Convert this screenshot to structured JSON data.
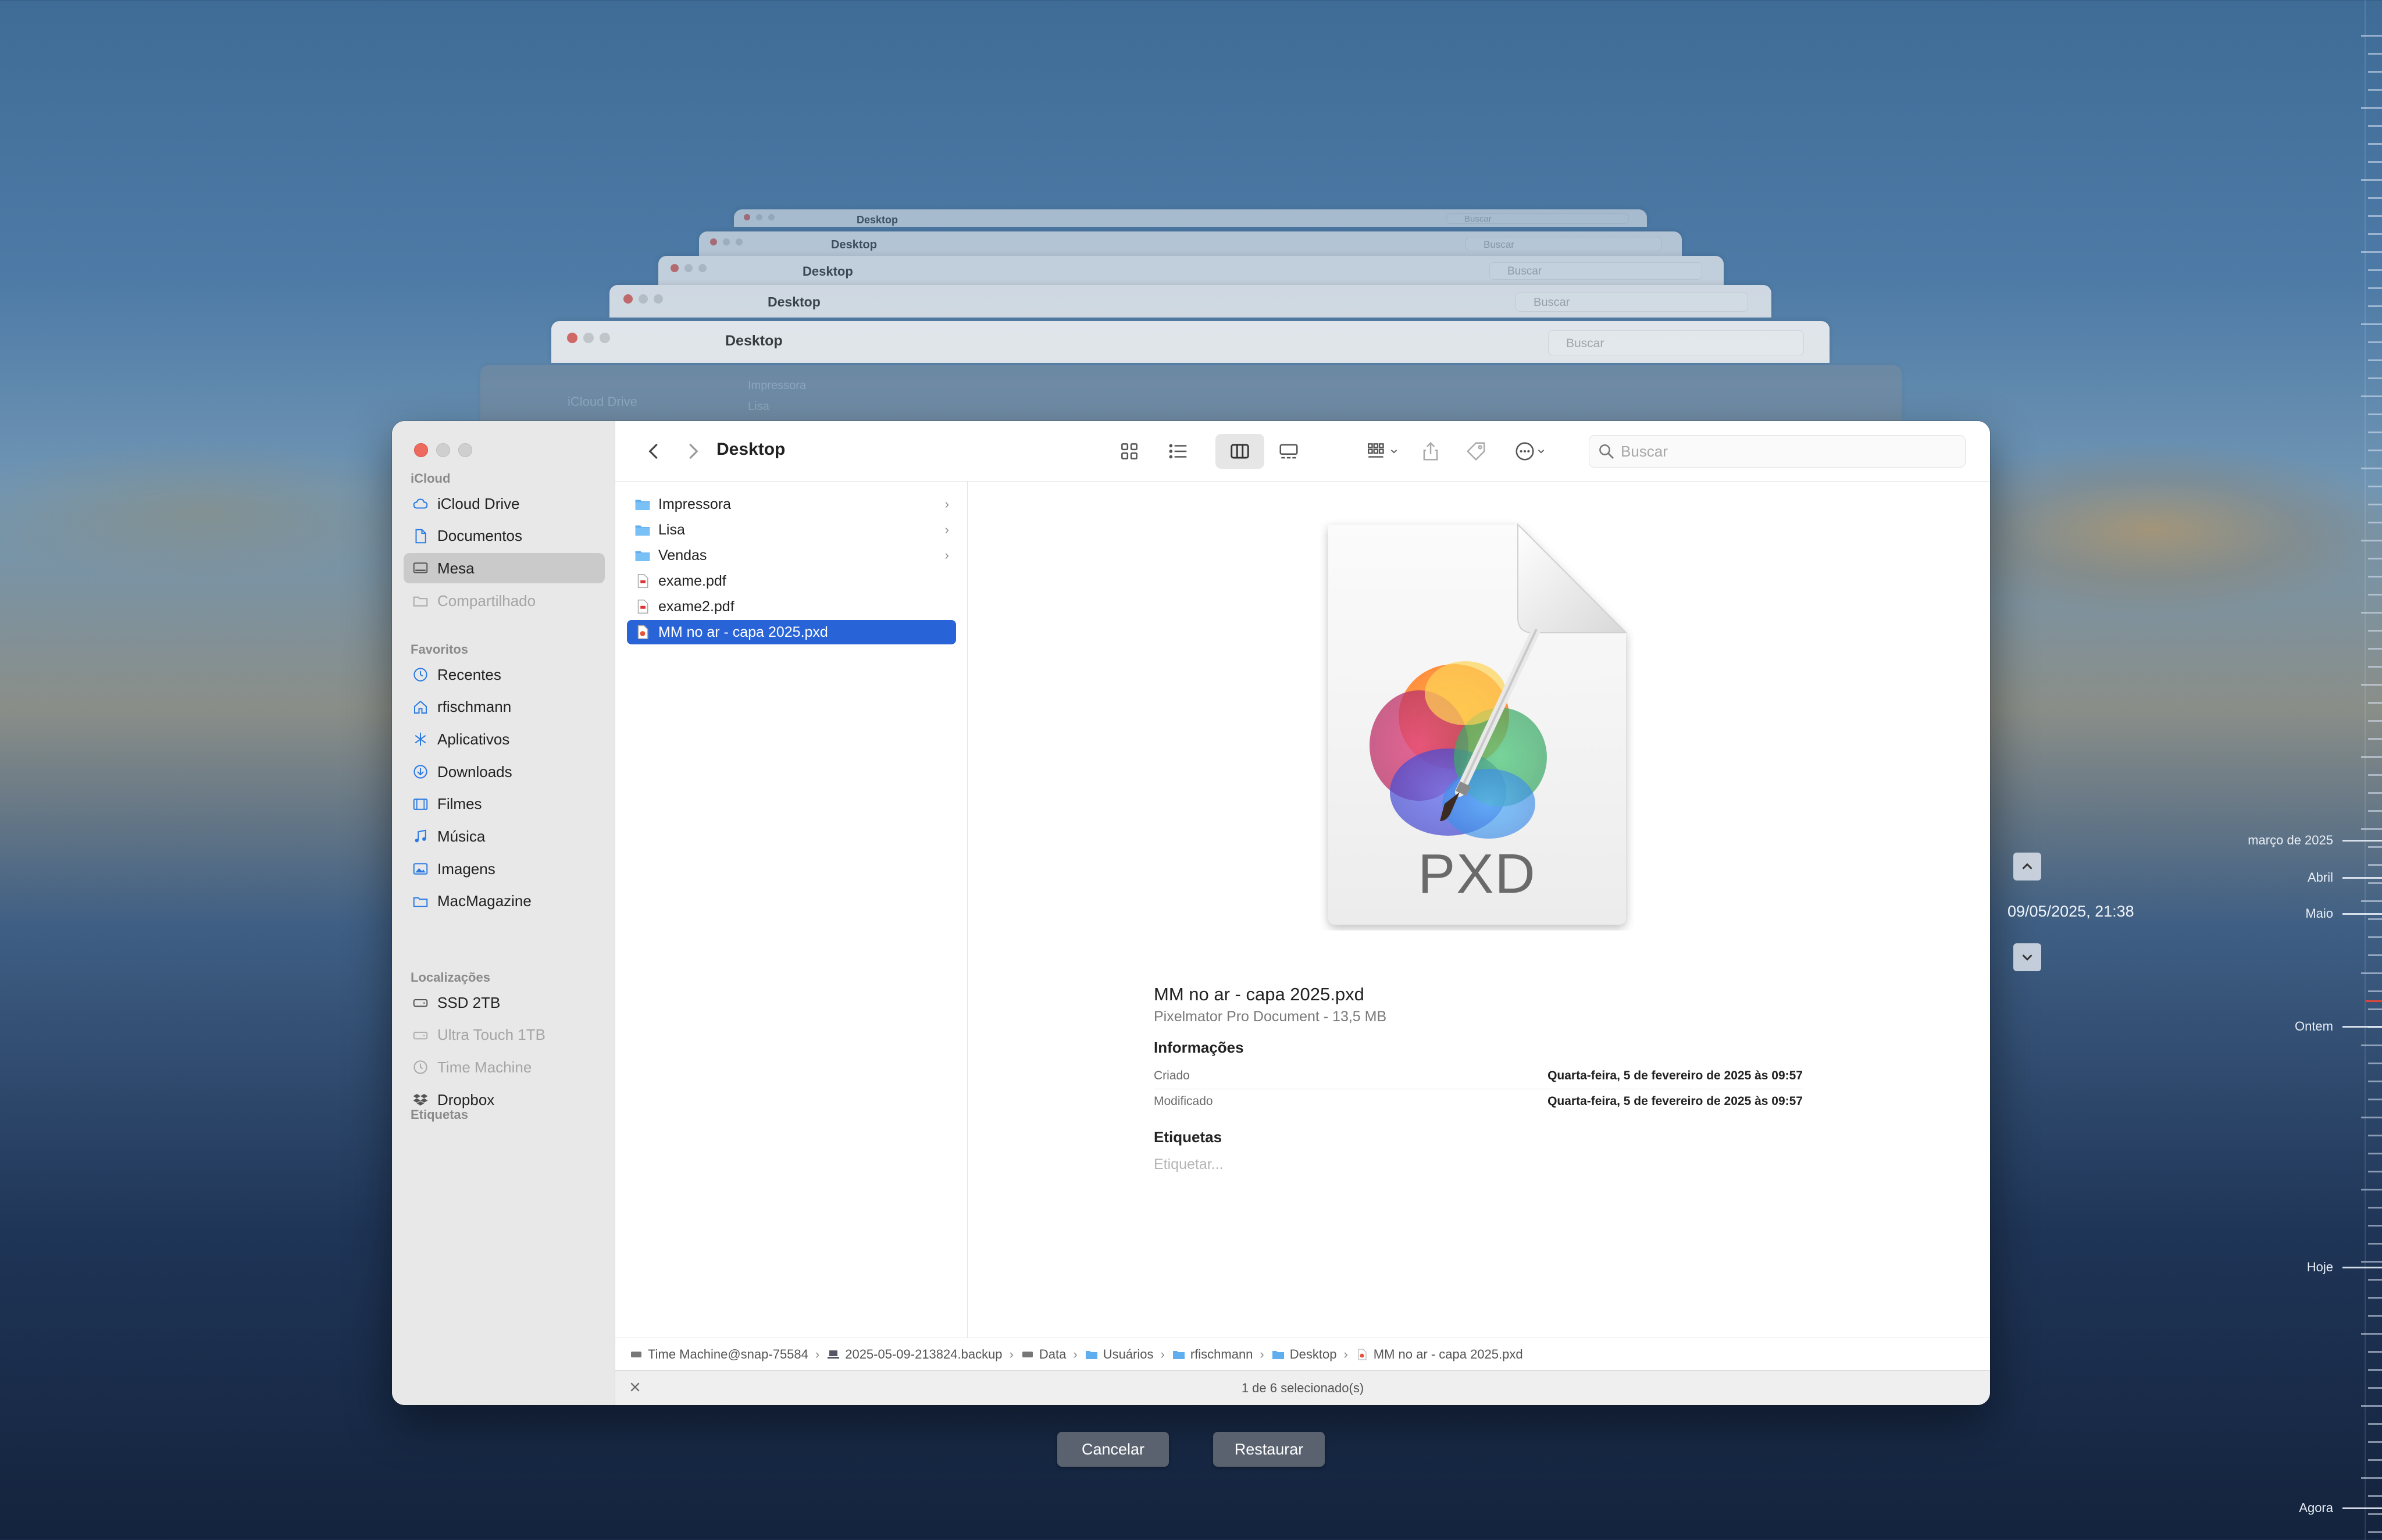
{
  "window": {
    "title": "Desktop",
    "search_placeholder": "Buscar"
  },
  "sidebar": {
    "sections": [
      {
        "title": "iCloud",
        "items": [
          {
            "label": "iCloud Drive",
            "icon": "cloud-icon"
          },
          {
            "label": "Documentos",
            "icon": "document-icon"
          },
          {
            "label": "Mesa",
            "icon": "desktop-icon",
            "active": true
          },
          {
            "label": "Compartilhado",
            "icon": "shared-folder-icon",
            "dim": true
          }
        ]
      },
      {
        "title": "Favoritos",
        "items": [
          {
            "label": "Recentes",
            "icon": "clock-icon"
          },
          {
            "label": "rfischmann",
            "icon": "home-icon"
          },
          {
            "label": "Aplicativos",
            "icon": "apps-icon"
          },
          {
            "label": "Downloads",
            "icon": "download-icon"
          },
          {
            "label": "Filmes",
            "icon": "film-icon"
          },
          {
            "label": "Música",
            "icon": "music-icon"
          },
          {
            "label": "Imagens",
            "icon": "photo-icon"
          },
          {
            "label": "MacMagazine",
            "icon": "folder-icon"
          }
        ]
      },
      {
        "title": "Localizações",
        "items": [
          {
            "label": "SSD 2TB",
            "icon": "drive-icon"
          },
          {
            "label": "Ultra Touch 1TB",
            "icon": "drive-icon",
            "dim": true
          },
          {
            "label": "Time Machine",
            "icon": "time-machine-icon",
            "dim": true
          },
          {
            "label": "Dropbox",
            "icon": "dropbox-icon"
          }
        ]
      },
      {
        "title": "Etiquetas",
        "items": []
      }
    ]
  },
  "files": [
    {
      "name": "Impressora",
      "type": "folder"
    },
    {
      "name": "Lisa",
      "type": "folder"
    },
    {
      "name": "Vendas",
      "type": "folder"
    },
    {
      "name": "exame.pdf",
      "type": "pdf"
    },
    {
      "name": "exame2.pdf",
      "type": "pdf"
    },
    {
      "name": "MM no ar - capa 2025.pxd",
      "type": "pxd",
      "selected": true
    }
  ],
  "preview": {
    "badge": "PXD",
    "name": "MM no ar - capa 2025.pxd",
    "kind": "Pixelmator Pro Document - 13,5 MB",
    "info_title": "Informações",
    "created_label": "Criado",
    "created_value": "Quarta-feira, 5 de fevereiro de 2025 às 09:57",
    "modified_label": "Modificado",
    "modified_value": "Quarta-feira, 5 de fevereiro de 2025 às 09:57",
    "tags_title": "Etiquetas",
    "tags_placeholder": "Etiquetar..."
  },
  "pathbar": [
    "Time Machine@snap-75584",
    "2025-05-09-213824.backup",
    "Data",
    "Usuários",
    "rfischmann",
    "Desktop",
    "MM no ar - capa 2025.pxd"
  ],
  "status": "1 de 6 selecionado(s)",
  "buttons": {
    "cancel": "Cancelar",
    "restore": "Restaurar"
  },
  "timemachine": {
    "current_date": "09/05/2025, 21:38",
    "labels": [
      "março de 2025",
      "Abril",
      "Maio",
      "Ontem",
      "Hoje",
      "Agora"
    ]
  },
  "ghost_windows": {
    "title": "Desktop",
    "search_placeholder": "Buscar",
    "sidebar_label": "iCloud Drive",
    "row_labels": [
      "Impressora",
      "Lisa"
    ]
  },
  "colors": {
    "accent": "#2864d8",
    "close": "#ee6a5e"
  }
}
